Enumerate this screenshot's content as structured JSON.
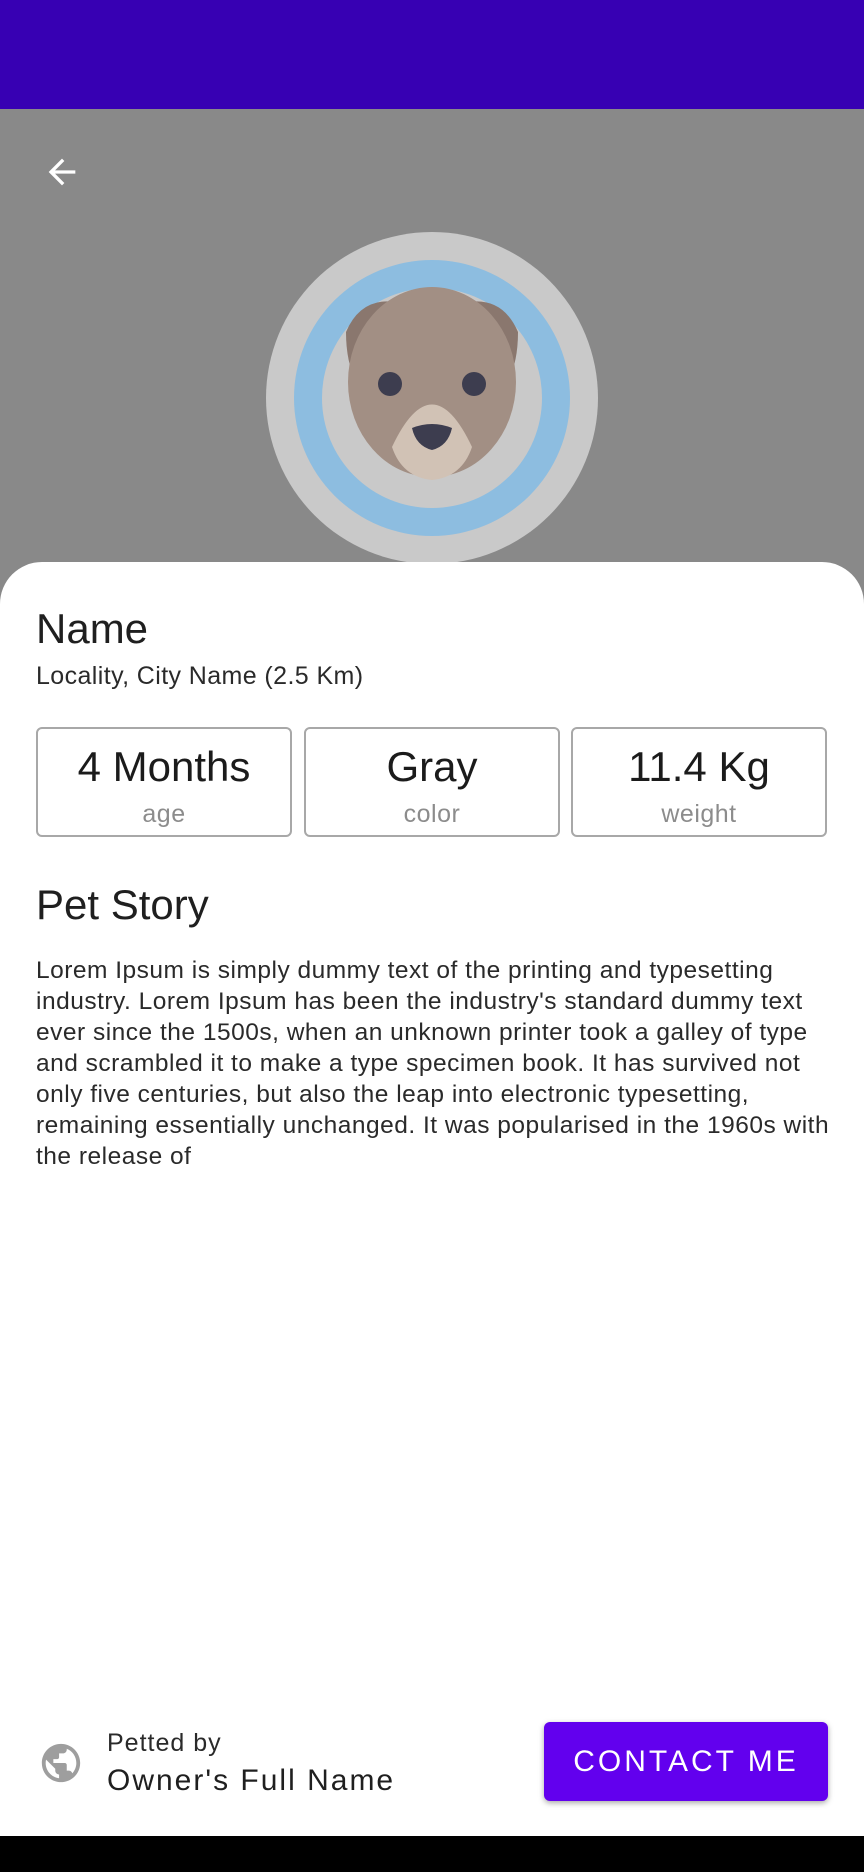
{
  "colors": {
    "status_bar": "#3700B3",
    "hero_background": "#898989",
    "accent": "#6200EE",
    "nav_bar": "#000000"
  },
  "header": {
    "back_icon": "arrow-back-icon"
  },
  "avatar": {
    "icon": "dog-avatar-icon"
  },
  "pet": {
    "name": "Name",
    "location": "Locality, City Name (2.5 Km)"
  },
  "stats": [
    {
      "value": "4 Months",
      "label": "age"
    },
    {
      "value": "Gray",
      "label": "color"
    },
    {
      "value": "11.4 Kg",
      "label": "weight"
    }
  ],
  "story": {
    "title": "Pet Story",
    "text": "Lorem Ipsum is simply dummy text of the printing and typesetting industry. Lorem Ipsum has been the industry's standard dummy text ever since the 1500s, when an unknown printer took a galley of type and scrambled it to make a type specimen book. It has survived not only five centuries, but also the leap into electronic typesetting, remaining essentially unchanged. It was popularised in the 1960s with the release of"
  },
  "owner": {
    "icon": "globe-icon",
    "prefix": "Petted by",
    "name": "Owner's Full Name"
  },
  "actions": {
    "contact_label": "CONTACT ME"
  }
}
